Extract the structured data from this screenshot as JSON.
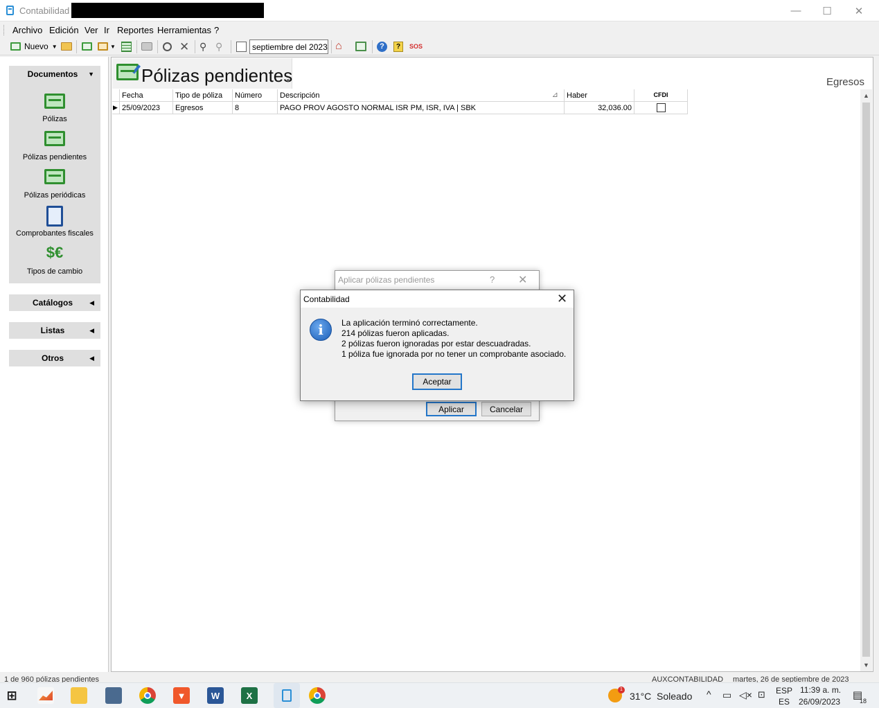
{
  "window": {
    "title": "Contabilidad -",
    "min": "—",
    "max": "☐",
    "close": "✕"
  },
  "menu": [
    "Archivo",
    "Edición",
    "Ver",
    "Ir",
    "Reportes",
    "Herramientas",
    "?"
  ],
  "toolbar": {
    "new_label": "Nuevo",
    "period": "septiembre del 2023",
    "sos": "SOS"
  },
  "sidebar": {
    "documentos": {
      "title": "Documentos",
      "items": [
        "Pólizas",
        "Pólizas pendientes",
        "Pólizas periódicas",
        "Comprobantes fiscales",
        "Tipos de cambio"
      ]
    },
    "catalogos": "Catálogos",
    "listas": "Listas",
    "otros": "Otros"
  },
  "main": {
    "title": "Pólizas pendientes",
    "filter_label": "Egresos",
    "columns": [
      "Fecha",
      "Tipo de póliza",
      "Número",
      "Descripción",
      "Haber",
      "CFDI"
    ],
    "rows": [
      {
        "fecha": "25/09/2023",
        "tipo": "Egresos",
        "numero": "8",
        "descripcion": "PAGO PROV AGOSTO NORMAL ISR PM, ISR, IVA | SBK",
        "haber": "32,036.00",
        "cfdi": false
      }
    ]
  },
  "status": {
    "left": "1 de 960 pólizas pendientes",
    "mid": "AUXCONTABILIDAD",
    "right": "martes, 26 de septiembre de 2023"
  },
  "dialog_back": {
    "title": "Aplicar pólizas pendientes",
    "help": "?",
    "apply": "Aplicar",
    "cancel": "Cancelar"
  },
  "dialog": {
    "title": "Contabilidad",
    "lines": [
      "La aplicación terminó correctamente.",
      "214 pólizas fueron aplicadas.",
      "2 pólizas fueron ignoradas por estar descuadradas.",
      "1 póliza fue ignorada por no tener un comprobante asociado."
    ],
    "ok": "Aceptar"
  },
  "taskbar": {
    "weather_temp": "31°C",
    "weather_text": "Soleado",
    "weather_badge": "1",
    "lang_top": "ESP",
    "lang_bottom": "ES",
    "time": "11:39 a. m.",
    "date": "26/09/2023",
    "notifications": "18"
  },
  "colors": {
    "accent": "#2376c9",
    "green_icon": "#2f8f2f",
    "info_blue": "#1b5eb7"
  }
}
